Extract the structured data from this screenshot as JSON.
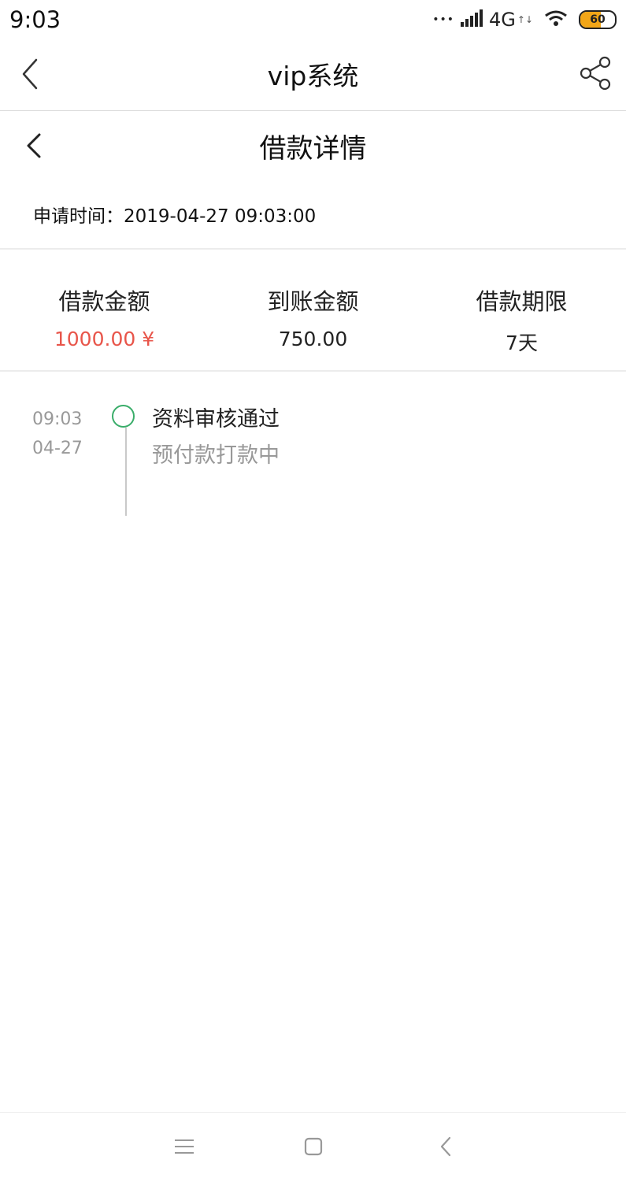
{
  "status_bar": {
    "time": "9:03",
    "dots": "•••",
    "network": "4G",
    "network_arrows": "↑↓",
    "battery_level": "60",
    "battery_color": "#f2a618"
  },
  "nav": {
    "back_icon": "chevron-left-icon",
    "title": "vip系统",
    "share_icon": "share-icon"
  },
  "subheader": {
    "back_icon": "chevron-left-icon",
    "title": "借款详情"
  },
  "apply": {
    "text": "申请时间：2019-04-27 09:03:00"
  },
  "summary": [
    {
      "label": "借款金额",
      "value": "1000.00 ¥",
      "color": "#e8554a"
    },
    {
      "label": "到账金额",
      "value": "750.00"
    },
    {
      "label": "借款期限",
      "value": "7天"
    }
  ],
  "timeline": [
    {
      "time": "09:03",
      "date": "04-27",
      "title": "资料审核通过",
      "subtitle": "预付款打款中",
      "dot_color": "#3aad6a"
    }
  ],
  "bottom_nav": {
    "menu_icon": "menu-icon",
    "home_icon": "home-square-icon",
    "back_icon": "back-triangle-icon"
  }
}
